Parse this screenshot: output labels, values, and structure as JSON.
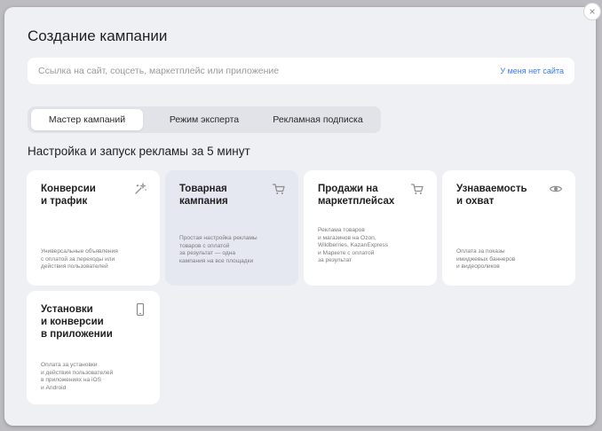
{
  "modal": {
    "title": "Создание кампании",
    "url_placeholder": "Ссылка на сайт, соцсеть, маркетплейс или приложение",
    "url_value": "",
    "no_site_link": "У меня нет сайта",
    "close_symbol": "×",
    "tabs": [
      {
        "label": "Мастер кампаний",
        "active": true
      },
      {
        "label": "Режим эксперта",
        "active": false
      },
      {
        "label": "Рекламная подписка",
        "active": false
      }
    ],
    "section_title": "Настройка и запуск рекламы за 5 минут",
    "cards": [
      {
        "title": "Конверсии\nи трафик",
        "icon": "magic-wand-icon",
        "desc": "Универсальные объявления\nс оплатой за переходы или\nдействия пользователей"
      },
      {
        "title": "Товарная\nкампания",
        "icon": "cart-icon",
        "desc": "Простая настройка рекламы\nтоваров с оплатой\nза результат — одна\nкампания на все площадки"
      },
      {
        "title": "Продажи на\nмаркетплейсах",
        "icon": "cart-icon",
        "desc": "Реклама товаров\nи магазинов на Ozon,\nWildberries, KazanExpress\nи Маркете с оплатой\nза результат"
      },
      {
        "title": "Узнаваемость\nи охват",
        "icon": "eye-icon",
        "desc": "Оплата за показы\nимиджевых баннеров\nи видеороликов"
      },
      {
        "title": "Установки\nи конверсии\nв приложении",
        "icon": "phone-icon",
        "desc": "Оплата за установки\nи действия пользователей\nв приложениях на iOS\nи Android"
      }
    ]
  },
  "colors": {
    "modal_bg": "#eff0f4",
    "card_bg": "#ffffff",
    "card_hover_bg": "#e6e8f1",
    "link": "#3a7af0",
    "icon_gray": "#8c8c8c"
  }
}
